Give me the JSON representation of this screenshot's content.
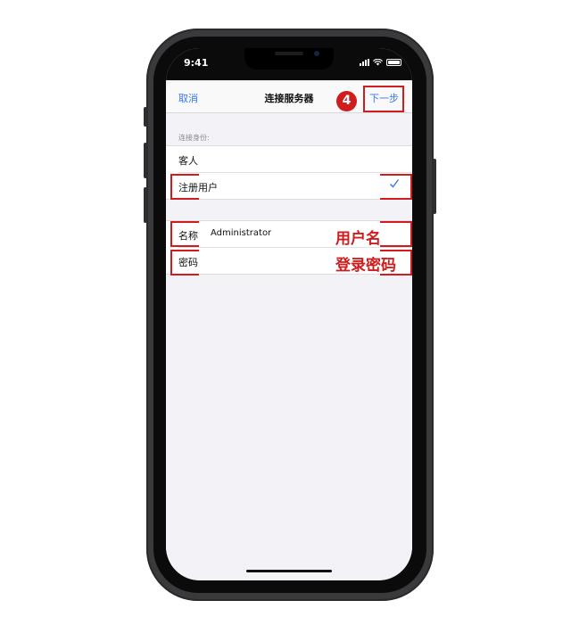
{
  "status_bar": {
    "time": "9:41"
  },
  "nav": {
    "cancel_label": "取消",
    "title": "连接服务器",
    "next_label": "下一步"
  },
  "identity": {
    "section_header": "连接身份:",
    "options": [
      {
        "label": "客人",
        "selected": false
      },
      {
        "label": "注册用户",
        "selected": true
      }
    ]
  },
  "credentials": {
    "name_label": "名称",
    "name_value": "Administrator",
    "password_label": "密码",
    "password_value": ""
  },
  "annotations": {
    "step_number": "4",
    "username_note": "用户名",
    "password_note": "登录密码",
    "color": "#d01c1c"
  },
  "colors": {
    "accent": "#3478f6",
    "background": "#f2f2f7"
  }
}
